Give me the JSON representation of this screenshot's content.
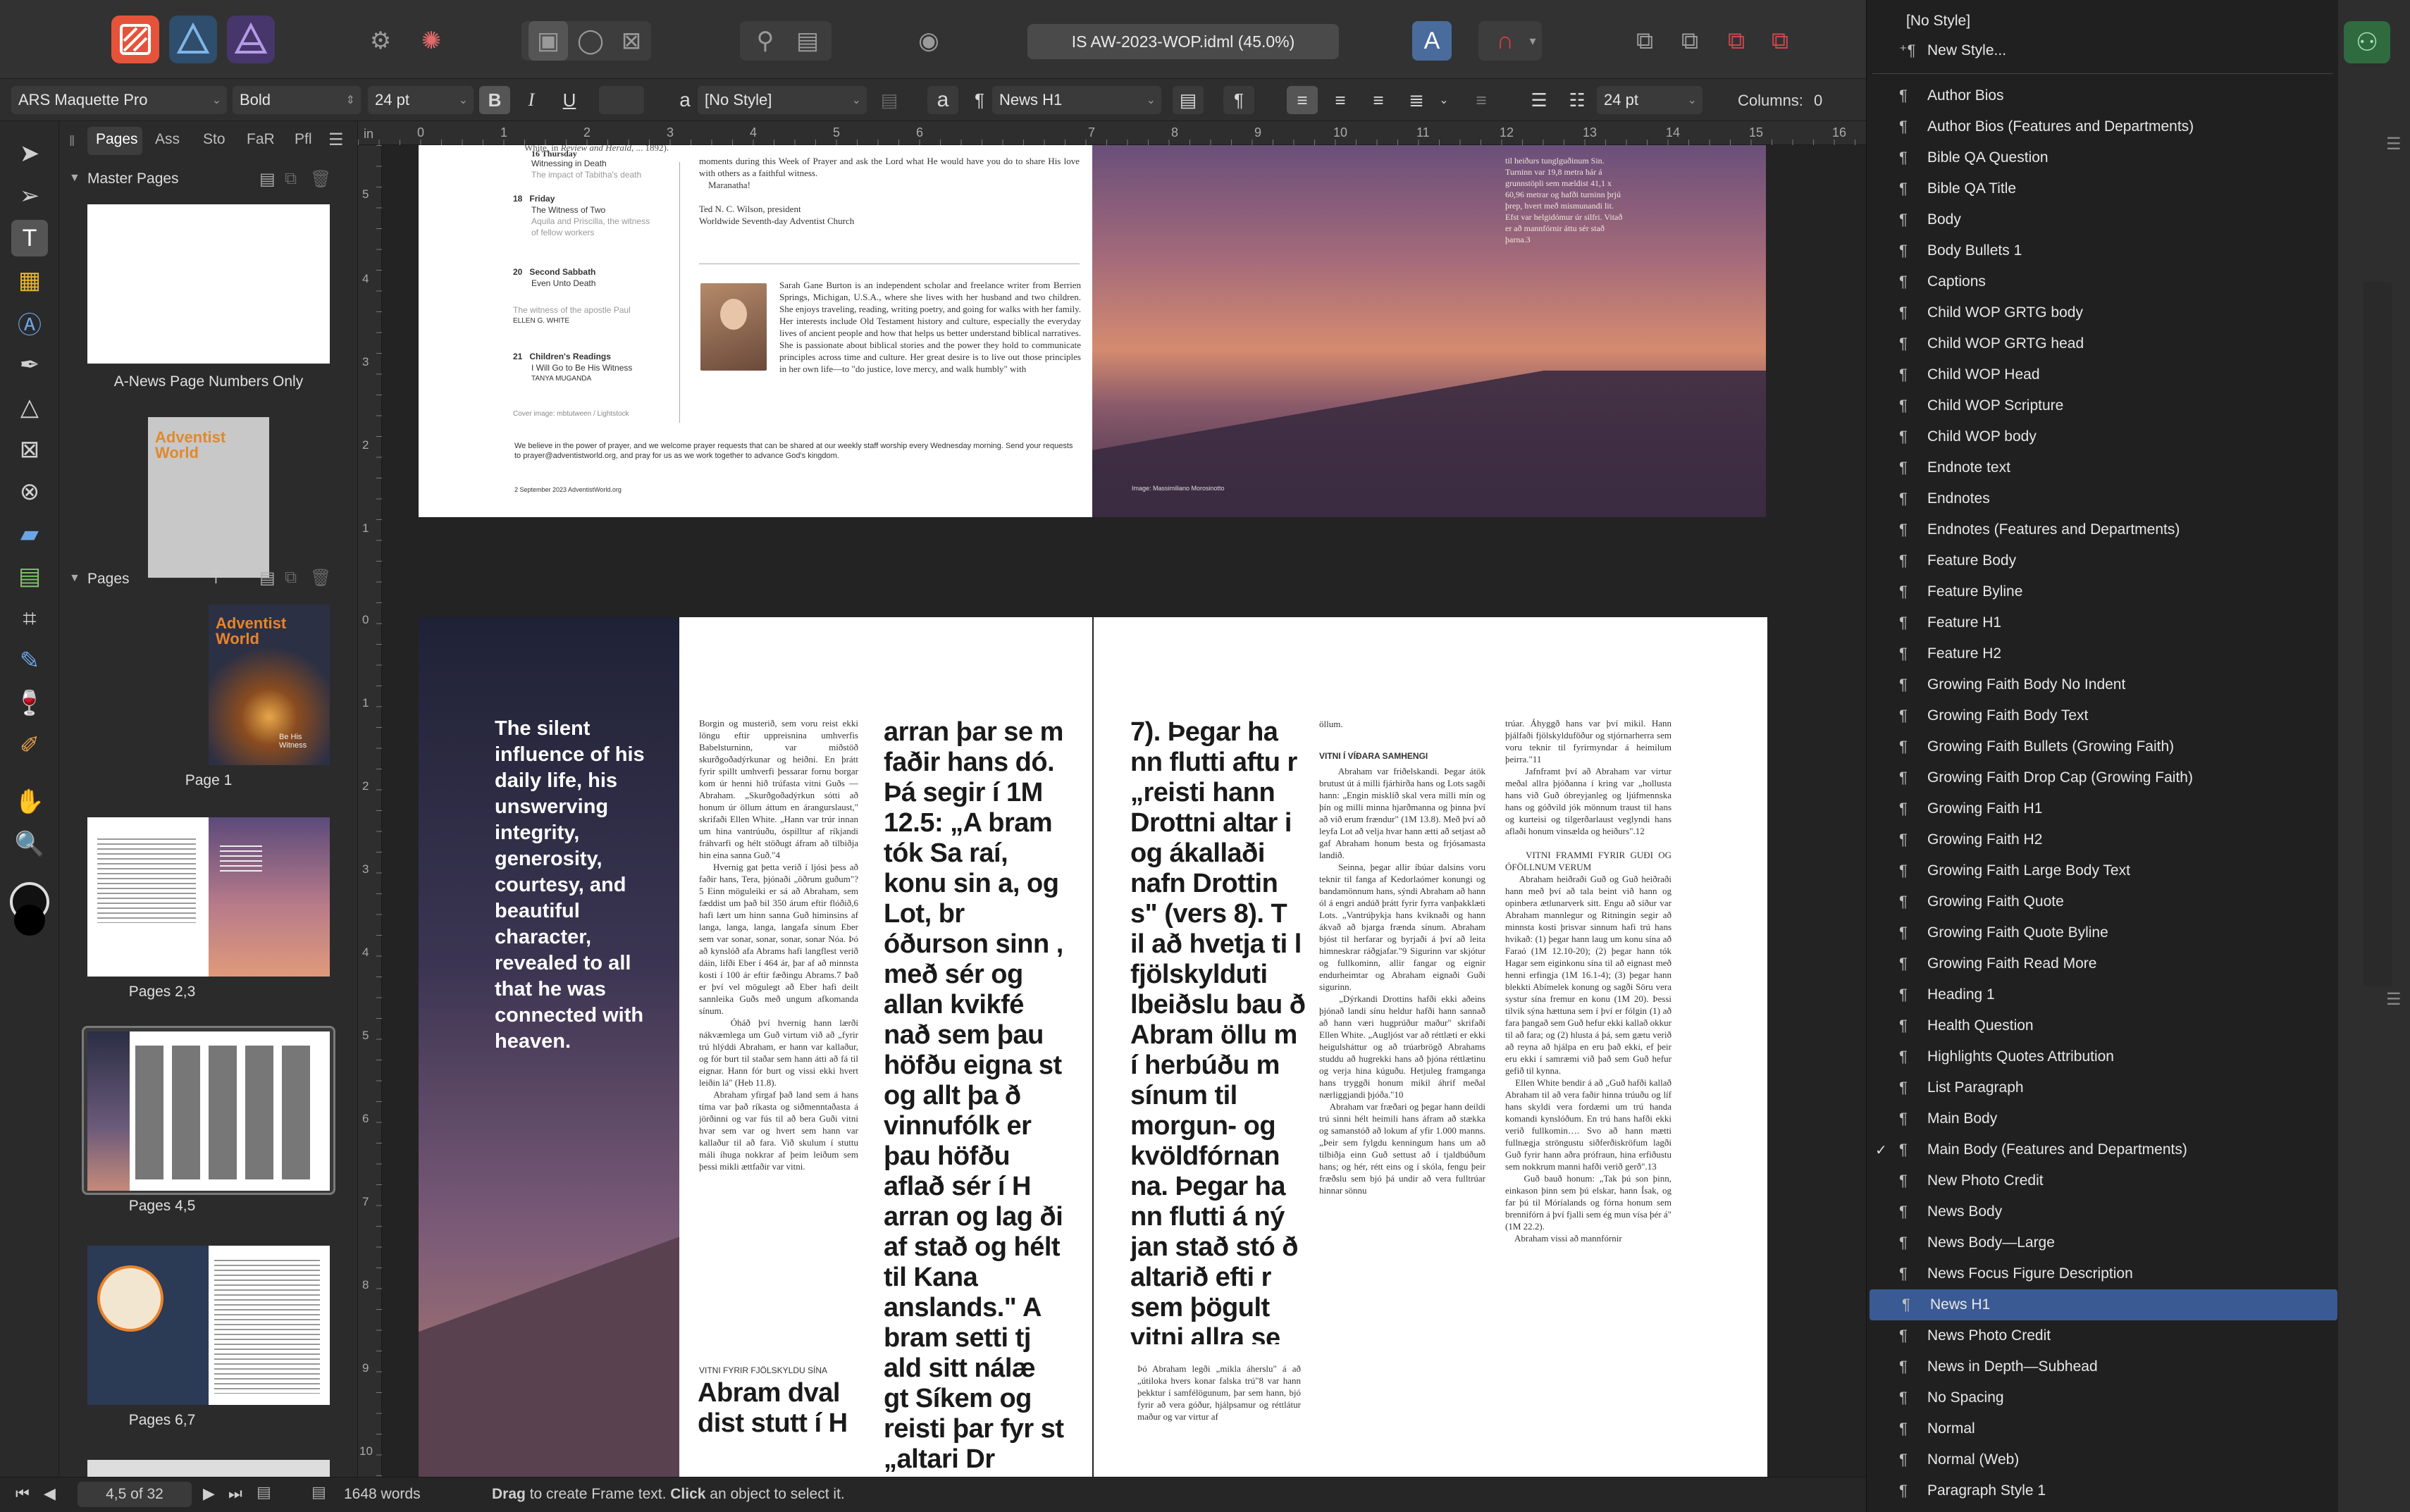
{
  "toolbar": {
    "personas": [
      "Publisher",
      "Designer",
      "Photo"
    ],
    "document_title": "IS AW-2023-WOP.idml (45.0%)"
  },
  "context": {
    "font_family": "ARS Maquette Pro",
    "font_style": "Bold",
    "font_size": "24 pt",
    "bold": "B",
    "italic": "I",
    "underline": "U",
    "char_style": "[No Style]",
    "char_a": "a",
    "para_mark": "¶",
    "para_style": "News H1",
    "leading": "24 pt",
    "columns_label": "Columns:",
    "columns_value": "0"
  },
  "panel": {
    "tabs": [
      "Pages",
      "Ass",
      "Sto",
      "FaR",
      "Pfl"
    ],
    "master_pages_label": "Master Pages",
    "pages_label": "Pages",
    "master_thumbs": [
      "A-News Page Numbers Only"
    ],
    "master_cover": {
      "line1": "Adventist",
      "line2": "World"
    },
    "page_thumbs": [
      "Page 1",
      "Pages 2,3",
      "Pages 4,5",
      "Pages 6,7"
    ],
    "cover": {
      "title": "Adventist World",
      "subtitle": "Be His Witness"
    }
  },
  "ruler": {
    "h": [
      "0",
      "1",
      "2",
      "3",
      "4",
      "5",
      "6",
      "7",
      "8",
      "9",
      "10",
      "11",
      "12",
      "13",
      "14",
      "15",
      "16"
    ],
    "unit": "in",
    "v": [
      "5",
      "4",
      "3",
      "2",
      "1",
      "0",
      "1",
      "2",
      "3",
      "4",
      "5",
      "6",
      "7",
      "8",
      "9",
      "10"
    ]
  },
  "spread1": {
    "schedule": [
      {
        "day": "",
        "title": "Witnessing in Death",
        "sub": "The impact of Tabitha's death",
        "author": ""
      },
      {
        "day": "18",
        "dayname": "Friday",
        "title": "The Witness of Two",
        "sub": "Aquila and Priscilla, the witness of fellow workers",
        "author": ""
      },
      {
        "day": "20",
        "dayname": "Second Sabbath",
        "title": "Even Unto Death",
        "sub": "The witness of the apostle Paul",
        "author": "ELLEN G. WHITE"
      },
      {
        "day": "21",
        "dayname": "Children's Readings",
        "title": "I Will Go to Be His Witness",
        "sub": "",
        "author": "TANYA MUGANDA"
      }
    ],
    "day16": "16 Thursday",
    "cover_credit": "Cover image: mbtutween / Lightstock",
    "letter": "moments during this Week of Prayer and ask the Lord what He would have you do to share His love with others as a faithful witness.\n    Maranatha!\n\nTed N. C. Wilson, president\nWorldwide Seventh-day Adventist Church",
    "bio": "Sarah Gane Burton is an independent scholar and freelance writer from Berrien Springs, Michigan, U.S.A., where she lives with her husband and two children. She enjoys traveling, reading, writing poetry, and going for walks with her family. Her interests include Old Testament history and culture, especially the everyday lives of ancient people and how that helps us better understand biblical narratives. She is passionate about biblical stories and the power they hold to communicate principles across time and culture. Her great desire is to live out those principles in her own life—to \"do justice, love mercy, and walk humbly\" with",
    "prayer_note": "We believe in the power of prayer, and we welcome prayer requests that can be shared at our weekly staff worship every Wednesday morning. Send your requests to prayer@adventistworld.org, and pray for us as we work together to advance God's kingdom.",
    "folio": "2     September 2023   AdventistWorld.org",
    "image_credit": "Image: Massimiliano Morosinotto",
    "overlay_text": "til heiðurs tunglguðinum Sin. Turninn var 19,8 metra hár á grunnstöpli sem mældist 41,1 x 60,96 metrar og hafði turninn þrjú þrep, hvert með mismunandi lit. Efst var helgidómur úr silfri. Vitað er að mannfórnir áttu sér stað þarna.3"
  },
  "spread2": {
    "pullquote": "The silent influence of his daily life, his unswerving integrity, generosity, courtesy, and beautiful character, revealed to all that he was connected with heaven.",
    "col1": "Borgin og musterið, sem voru reist ekki löngu eftir uppreisnina umhverfis Babelsturninn, var miðstöð skurðgoðadýrkunar og heiðni. En þrátt fyrir spillt umhverfi þessarar fornu borgar kom úr henni hið trúfasta vitni Guðs — Abraham. „Skurðgoðadýrkun sótti að honum úr öllum áttum en árangurslaust,\" skrifaði Ellen White. „Hann var trúr innan um hina vantrúuðu, óspilltur af ríkjandi fráhvarfi og hélt stöðugt áfram að tilbiðja hin eina sanna Guð.\"4\n    Hvernig gat þetta verið í ljósi þess að faðir hans, Tera, þjónaði „öðrum guðum\"?5 Einn möguleiki er sá að Abraham, sem fæddist um það bil 350 árum eftir flóðið,6 hafi lært um hinn sanna Guð himinsins af langa, langa, langa, langafa sínum Eber sem var sonar, sonar, sonar, sonar Nóa. Þó að kynslóð afa Abrams hafi langflest verið dáin, lifði Eber í 464 ár, þar af að minnsta kosti í 100 ár eftir fæðingu Abrams.7 Það er því vel mögulegt að Eber hafi deilt sannleika Guðs með ungum afkomanda sínum.\n    Óháð því hvernig hann lærði nákvæmlega um Guð virtum við að „fyrir trú hlýddi Abraham, er hann var kallaður, og fór burt til staðar sem hann átti að fá til eignar. Hann fór burt og vissi ekki hvert leiðin lá\" (Heb 11.8).\n    Abraham yfirgaf það land sem á hans tíma var það ríkasta og siðmenntaðasta á jörðinni og var fús til að bera Guði vitni hvar sem var og hvert sem hann var kallaður til að fara. Við skulum í stuttu máli íhuga nokkrar af þeim leiðum sem þessi mikli ættfaðir var vitni.",
    "col1_head": "VITNI FYRIR FJÖLSKYLDU SÍNA",
    "col1_big": "Abram dval dist stutt í H",
    "big1": "arran þar se m faðir hans dó. Þá segir í 1M 12.5: „A bram tók Sa raí, konu sin a, og Lot, br óðurson sinn , með sér og allan kvikfé nað sem þau höfðu eigna st og allt þa ð vinnufólk er þau höfðu aflað sér í H arran og lag ði af stað og hélt til Kana anslands.\" A bram setti tj ald sitt nálæ gt Síkem og reisti þar fyr st „altari Dr ottni\" (vers",
    "big2": "7). Þegar ha nn flutti aftu r „reisti hann Drottni altar i og ákallaði nafn Drottin s\" (vers 8). T il að hvetja ti l fjölskylduti lbeiðslu bau ð Abram öllu m í herbúðu m sínum til morgun- og kvöldfórnan na. Þegar ha nn flutti á ný jan stað stó ð altarið efti r sem þögult vitni allra se m fram hjá f óru.",
    "col3_tail": "Þó Abraham legði „mikla áherslu\" á að „útiloka hvers konar falska trú\"8 var hann þekktur í samfélögunum, þar sem hann, bjó fyrir að vera góður, hjálpsamur og réttlátur maður og var virtur af",
    "col4_top": "öllum.",
    "col4_head": "VITNI Í VÍÐARA SAMHENGI",
    "col4": "    Abraham var friðelskandi. Þegar átök brutust út á milli fjárhirða hans og Lots sagði hann: „Engin misklíð skal vera milli mín og þín og milli minna hjarðmanna og þinna því að við erum frændur\" (1M 13.8). Með því að leyfa Lot að velja hvar hann ætti að setjast að gaf Abraham honum besta og frjósamasta landið.\n    Seinna, þegar allir íbúar dalsins voru teknir til fanga af Kedorlaómer konungi og bandamönnum hans, sýndi Abraham að hann ól á engri andúð þrátt fyrir fyrra vanþakklæti Lots. „Vantrúþykja hans kviknaði og hann ákvað að bjarga frænda sínum. Abraham bjóst til herfarar og byrjaði á því að leita himneskrar ráðgjafar.\"9 Sigurinn var skjótur og fullkominn, allir fangar og eignir endurheimtar og Abraham eignaði Guði sigurinn.\n    „Dýrkandi Drottins hafði ekki aðeins þjónað landi sínu heldur hafði hann sannað að hann væri hugprúður maður\" skrifaði Ellen White. „Augljóst var að réttlæti er ekki heigulsháttur og að trúarbrögð Abrahams studdu að hugrekki hans að þjóna réttlætinu og verja hina kúguðu. Hetjuleg framganga hans tryggði honum mikil áhrif meðal nærliggjandi þjóða.\"10\n    Abraham var fræðari og þegar hann deildi trú sinni hélt heimili hans áfram að stækka og samanstóð að lokum af yfir 1.000 manns. „Þeir sem fylgdu kenningum hans um að tilbiðja einn Guð settust að í tjaldbúðum hans; og hér, rétt eins og í skóla, fengu þeir fræðslu sem bjó þá undir að vera fulltrúar hinnar sönnu",
    "col5": "trúar. Áhyggð hans var því mikil. Hann þjálfaði fjölskylduföður og stjórnarherra sem voru teknir til fyrirmyndar á heimilum þeirra.\"11\n    Jafnframt því að Abraham var virtur meðal allra þjóðanna í kring var „hollusta hans við Guð óbreyjanleg og ljúfmennska hans og góðvild jók mönnum traust til hans og kurteisi og tilgerðarlaust veglyndi hans aflaði honum vinsælda og heiðurs\".12\n\n    VITNI FRAMMI FYRIR GUÐI OG ÓFÖLLNUM VERUM\n    Abraham heiðraði Guð og Guð heiðraði hann með því að tala beint við hann og opinbera ætlunarverk sitt. Engu að síður var Abraham mannlegur og Ritningin segir að minnsta kosti þrisvar sinnum hafi trú hans hvikað: (1) þegar hann laug um konu sína að Faraó (1M 12.10-20); (2) þegar hann tók Hagar sem eiginkonu sína til að eignast með henni erfingja (1M 16.1-4); (3) þegar hann blekkti Abímelek konung og sagði Söru vera systur sína fremur en konu (1M 20). Þessi tilvik sýna hættuna sem í því er fólgin (1) að fara þangað sem Guð hefur ekki kallað okkur til að fara; og (2) hlusta á þá, sem gætu verið að reyna að hjálpa en eru það ekki, ef þeir eru ekki í samræmi við það sem Guð hefur gefið til kynna.\n    Ellen White bendir á að „Guð hafði kallað Abraham til að vera faðir hinna trúuðu og líf hans skyldi vera fordæmi um trú handa komandi kynslóðum. En trú hans hafði ekki verið fullkomin…. Svo að hann mætti fullnægja ströngustu siðferðiskröfum lagði Guð fyrir hann aðra prófraun, hina erfiðustu sem nokkrum manni hafði verið gerð\".13\n    Guð bauð honum: „Tak þú son þinn, einkason þinn sem þú elskar, hann Ísak, og far þú til Móríalands og fórna honum sem brennifórn á því fjalli sem ég mun vísa þér á\" (1M 22.2).\n    Abraham vissi að mannfórnir"
  },
  "status": {
    "page_indicator": "4,5 of 32",
    "word_count": "1648 words",
    "hint_drag": "Drag",
    "hint_mid": " to create Frame text. ",
    "hint_click": "Click",
    "hint_end": " an object to select it."
  },
  "style_menu": {
    "top": [
      {
        "label": "[No Style]",
        "icon": false
      },
      {
        "label": "New Style...",
        "icon": true
      }
    ],
    "items": [
      "Author Bios",
      "Author Bios (Features and Departments)",
      "Bible QA Question",
      "Bible QA Title",
      "Body",
      "Body Bullets 1",
      "Captions",
      "Child WOP GRTG body",
      "Child WOP GRTG head",
      "Child WOP Head",
      "Child WOP Scripture",
      "Child WOP body",
      "Endnote text",
      "Endnotes",
      "Endnotes (Features and Departments)",
      "Feature Body",
      "Feature Byline",
      "Feature H1",
      "Feature H2",
      "Growing Faith Body No Indent",
      "Growing Faith Body Text",
      "Growing Faith Bullets (Growing Faith)",
      "Growing Faith Drop Cap (Growing Faith)",
      "Growing Faith H1",
      "Growing Faith H2",
      "Growing Faith Large Body Text",
      "Growing Faith Quote",
      "Growing Faith Quote Byline",
      "Growing Faith Read More",
      "Heading 1",
      "Health Question",
      "Highlights Quotes Attribution",
      "List Paragraph",
      "Main Body",
      "Main Body (Features and Departments)",
      "New Photo Credit",
      "News Body",
      "News Body—Large",
      "News Focus Figure Description",
      "News H1",
      "News Photo Credit",
      "News in Depth—Subhead",
      "No Spacing",
      "Normal",
      "Normal (Web)",
      "Paragraph Style 1"
    ],
    "checked": "Main Body (Features and Departments)",
    "selected": "News H1",
    "check_mark": "✓",
    "pilcrow": "¶"
  },
  "colors": {
    "publisher": "#e5543a",
    "designer": "#3d6f9c",
    "photo": "#6b4f9c",
    "selection": "#3a5a93",
    "accent_green": "#3ea55a"
  }
}
